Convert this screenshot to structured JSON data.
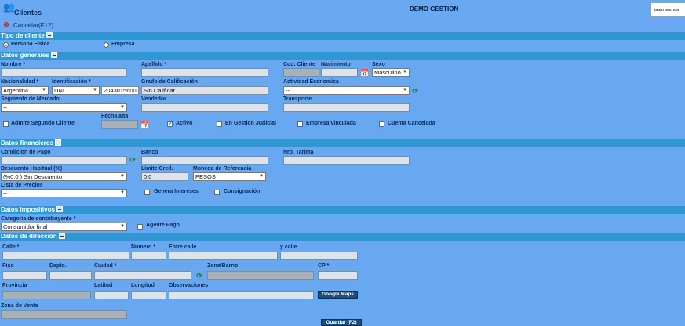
{
  "header": {
    "app_title": "Clientes",
    "center_title": "DEMO GESTION",
    "logo_text": "DEMO GESTION",
    "cancel_label": "Cancelar(F12)"
  },
  "tipo": {
    "section": "Tipo de cliente",
    "opt1": "Persona Física",
    "opt2": "Empresa",
    "selected": "Persona Física"
  },
  "generales": {
    "section": "Datos generales",
    "nombre_label": "Nombre *",
    "apellido_label": "Apellido *",
    "cod_label": "Cod. Cliente",
    "nac_label": "Nacimiento",
    "sexo_label": "Sexo",
    "sexo_value": "Masculino",
    "nacionalidad_label": "Nacionalidad *",
    "nacionalidad_value": "Argentina",
    "ident_label": "Identificación *",
    "ident_type": "DNI",
    "ident_number": "2043015600",
    "grado_label": "Grado de Calificación",
    "grado_value": "Sin Calificar",
    "actividad_label": "Actividad Economica",
    "actividad_value": "--",
    "segmento_label": "Segmento de Mercado",
    "segmento_value": "--",
    "vendedor_label": "Vendedor",
    "transporte_label": "Transporte",
    "fecha_alta_label": "Fecha alta",
    "admite_label": "Admite Segundo Cliente",
    "activo_label": "Activo",
    "judicial_label": "En Gestion Judicial",
    "vinculada_label": "Empresa vinculada",
    "cancelada_label": "Cuenta Cancelada"
  },
  "financieros": {
    "section": "Datos financieros",
    "cond_label": "Condicion de Pago",
    "banco_label": "Banco",
    "tarjeta_label": "Nro. Tarjeta",
    "desc_label": "Descuento Habitual (%)",
    "desc_value": "(%0.0 ) Sin Descuento",
    "limite_label": "Limite Cred.",
    "limite_value": "0.0",
    "moneda_label": "Moneda de Referencia",
    "moneda_value": "PESOS",
    "lista_label": "Lista de Precios",
    "lista_value": "--",
    "genera_label": "Genera Intereses",
    "consig_label": "Consignación"
  },
  "impositivos": {
    "section": "Datos impositivos",
    "cat_label": "Categoria de contribuyente *",
    "cat_value": "Consumidor final",
    "agente_label": "Agente Pago"
  },
  "direccion": {
    "section": "Datos de dirección",
    "calle_label": "Calle *",
    "numero_label": "Número *",
    "entre_label": "Entre calle",
    "ycalle_label": "y calle",
    "piso_label": "Piso",
    "depto_label": "Depto.",
    "ciudad_label": "Ciudad *",
    "zona_label": "Zona/Barrio",
    "cp_label": "CP *",
    "provincia_label": "Provincia",
    "latitud_label": "Latitud",
    "longitud_label": "Longitud",
    "obs_label": "Observaciones",
    "maps_label": "Google Maps",
    "zonaventa_label": "Zona de Venta"
  },
  "footer": {
    "save_label": "Guardar (F2)"
  },
  "colors": {
    "bg": "#68a8f0",
    "section": "#2f97d4",
    "button": "#1d4d78"
  }
}
